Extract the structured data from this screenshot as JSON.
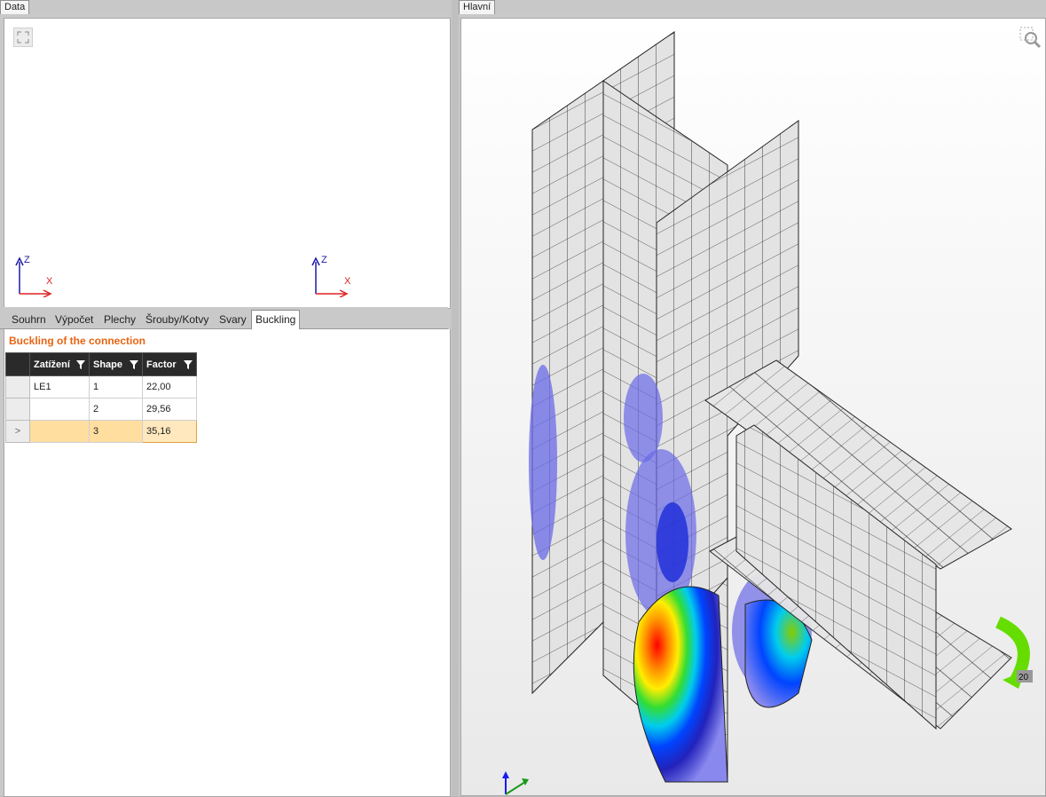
{
  "left_panel": {
    "tab_label": "Data",
    "preview": {
      "axis_left": {
        "z": "Z",
        "x": "X"
      },
      "axis_right": {
        "z": "Z",
        "x": "X"
      }
    },
    "tabs": [
      {
        "label": "Souhrn"
      },
      {
        "label": "Výpočet"
      },
      {
        "label": "Plechy"
      },
      {
        "label": "Šrouby/Kotvy"
      },
      {
        "label": "Svary"
      },
      {
        "label": "Buckling"
      }
    ],
    "active_tab": "Buckling",
    "section_title": "Buckling of the connection",
    "table": {
      "columns": [
        "Zatížení",
        "Shape",
        "Factor"
      ],
      "rows": [
        {
          "load": "LE1",
          "shape": "1",
          "factor": "22,00"
        },
        {
          "load": "",
          "shape": "2",
          "factor": "29,56"
        },
        {
          "load": "",
          "shape": "3",
          "factor": "35,16"
        }
      ],
      "selected_row": 2,
      "row_indicator": ">"
    }
  },
  "main_panel": {
    "tab_label": "Hlavní",
    "legend_value": "20"
  },
  "colors": {
    "accent_title": "#e86412",
    "selection": "#ffdea0",
    "header_dark": "#2a2a2a"
  }
}
